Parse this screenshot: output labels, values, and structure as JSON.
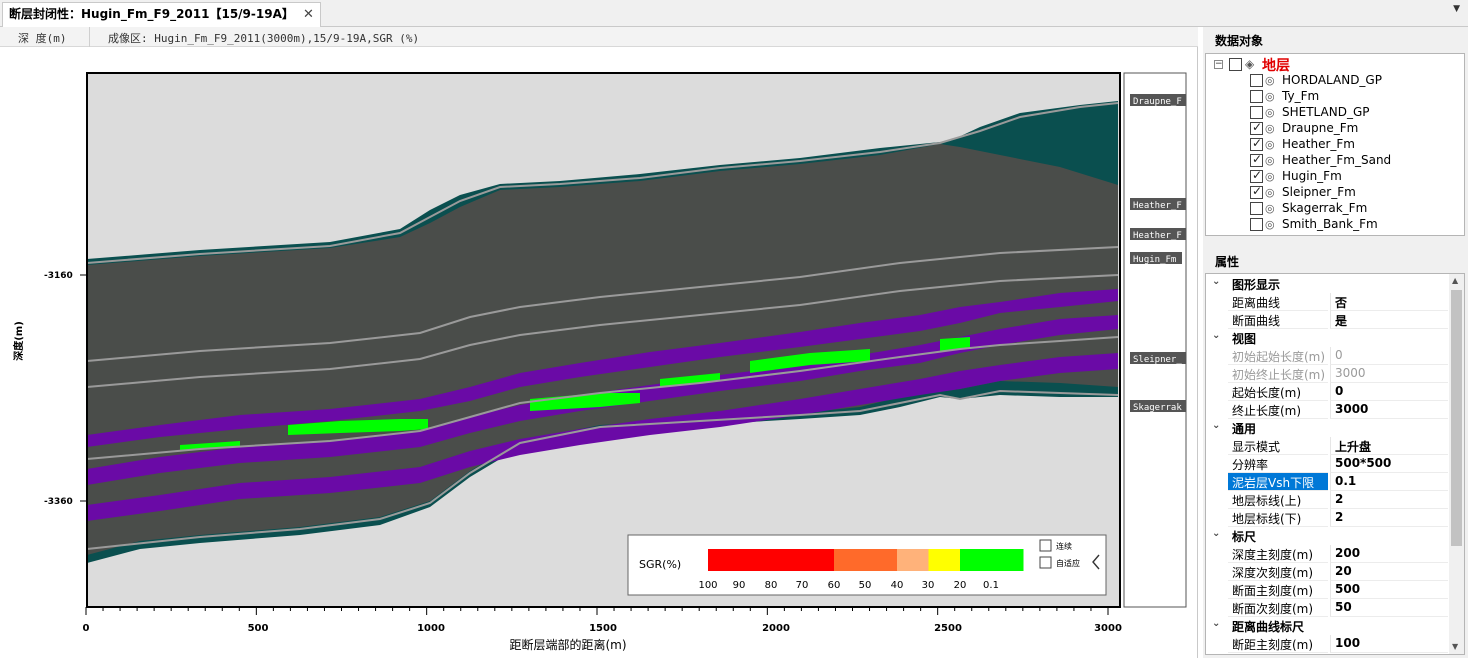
{
  "tab": {
    "title": "断层封闭性：Hugin_Fm_F9_2011【15/9-19A】",
    "close": "✕",
    "menu": "▼"
  },
  "subhead": {
    "depth_label": "深 度(m)",
    "section_label": "成像区: Hugin_Fm_F9_2011(3000m),15/9-19A,SGR (%)"
  },
  "plot": {
    "y_axis_label": "深度(m)",
    "x_axis_label": "距断层端部的距离(m)",
    "y_ticks": [
      "-3160",
      "-3360"
    ],
    "x_ticks": [
      "0",
      "500",
      "1000",
      "1500",
      "2000",
      "2500",
      "3000"
    ],
    "horizon_labels": [
      "Draupne_F",
      "Heather_F",
      "Heather_F",
      "Hugin_Fm",
      "Sleipner_",
      "Skagerrak"
    ]
  },
  "legend": {
    "title": "SGR(%)",
    "tick_labels": [
      "100",
      "90",
      "80",
      "70",
      "60",
      "50",
      "40",
      "30",
      "20",
      "0.1"
    ],
    "colors": [
      "#ff0000",
      "#ff0000",
      "#ff0000",
      "#ff0000",
      "#ff6a2a",
      "#ff6a2a",
      "#ffb27a",
      "#ffff00",
      "#00ff00",
      "#00ff00"
    ],
    "option_continuous": "连续",
    "option_auto": "自适应",
    "collapse_icon": "chevron-left-icon"
  },
  "colors": {
    "teal": "#0a4f4f",
    "gray_fill": "#4a4d4a",
    "purple": "#6a0aa6",
    "green": "#00ff00",
    "selection": "#0078d7"
  },
  "objects_panel": {
    "title": "数据对象",
    "root_label": "地层",
    "items": [
      {
        "label": "HORDALAND_GP",
        "checked": false
      },
      {
        "label": "Ty_Fm",
        "checked": false
      },
      {
        "label": "SHETLAND_GP",
        "checked": false
      },
      {
        "label": "Draupne_Fm",
        "checked": true
      },
      {
        "label": "Heather_Fm",
        "checked": true
      },
      {
        "label": "Heather_Fm_Sand",
        "checked": true
      },
      {
        "label": "Hugin_Fm",
        "checked": true
      },
      {
        "label": "Sleipner_Fm",
        "checked": true
      },
      {
        "label": "Skagerrak_Fm",
        "checked": false
      },
      {
        "label": "Smith_Bank_Fm",
        "checked": false
      }
    ]
  },
  "props_panel": {
    "title": "属性",
    "rows": [
      {
        "type": "cat",
        "name": "图形显示"
      },
      {
        "type": "prop",
        "name": "距离曲线",
        "value": "否"
      },
      {
        "type": "prop",
        "name": "断面曲线",
        "value": "是"
      },
      {
        "type": "cat",
        "name": "视图"
      },
      {
        "type": "prop",
        "name": "初始起始长度(m)",
        "value": "0",
        "readonly": true
      },
      {
        "type": "prop",
        "name": "初始终止长度(m)",
        "value": "3000",
        "readonly": true
      },
      {
        "type": "prop",
        "name": "起始长度(m)",
        "value": "0"
      },
      {
        "type": "prop",
        "name": "终止长度(m)",
        "value": "3000"
      },
      {
        "type": "cat",
        "name": "通用"
      },
      {
        "type": "prop",
        "name": "显示模式",
        "value": "上升盘"
      },
      {
        "type": "prop",
        "name": "分辨率",
        "value": "500*500"
      },
      {
        "type": "prop",
        "name": "泥岩层Vsh下限",
        "value": "0.1",
        "selected": true
      },
      {
        "type": "prop",
        "name": "地层标线(上)",
        "value": "2"
      },
      {
        "type": "prop",
        "name": "地层标线(下)",
        "value": "2"
      },
      {
        "type": "cat",
        "name": "标尺"
      },
      {
        "type": "prop",
        "name": "深度主刻度(m)",
        "value": "200"
      },
      {
        "type": "prop",
        "name": "深度次刻度(m)",
        "value": "20"
      },
      {
        "type": "prop",
        "name": "断面主刻度(m)",
        "value": "500"
      },
      {
        "type": "prop",
        "name": "断面次刻度(m)",
        "value": "50"
      },
      {
        "type": "cat",
        "name": "距离曲线标尺"
      },
      {
        "type": "prop",
        "name": "断距主刻度(m)",
        "value": "100"
      }
    ]
  }
}
